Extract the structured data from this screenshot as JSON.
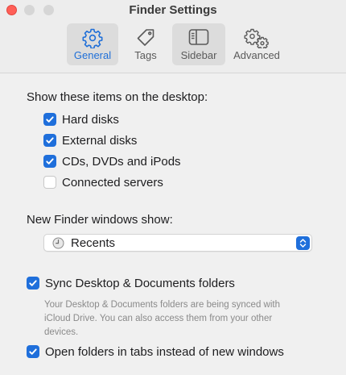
{
  "window": {
    "title": "Finder Settings"
  },
  "toolbar": {
    "tabs": [
      {
        "label": "General",
        "icon": "gear-icon",
        "active": true
      },
      {
        "label": "Tags",
        "icon": "tag-icon",
        "active": false
      },
      {
        "label": "Sidebar",
        "icon": "sidebar-icon",
        "active": false
      },
      {
        "label": "Advanced",
        "icon": "gears-icon",
        "active": false
      }
    ]
  },
  "desktop_items": {
    "heading": "Show these items on the desktop:",
    "options": [
      {
        "label": "Hard disks",
        "checked": true
      },
      {
        "label": "External disks",
        "checked": true
      },
      {
        "label": "CDs, DVDs and iPods",
        "checked": true
      },
      {
        "label": "Connected servers",
        "checked": false
      }
    ]
  },
  "new_window": {
    "heading": "New Finder windows show:",
    "selected": "Recents",
    "icon": "clock-icon"
  },
  "sync": {
    "label": "Sync Desktop & Documents folders",
    "checked": true,
    "description": "Your Desktop & Documents folders are being synced with iCloud Drive. You can also access them from your other devices."
  },
  "tabs_option": {
    "label": "Open folders in tabs instead of new windows",
    "checked": true
  },
  "colors": {
    "accent": "#1f6fdb",
    "close": "#ff5f57"
  }
}
